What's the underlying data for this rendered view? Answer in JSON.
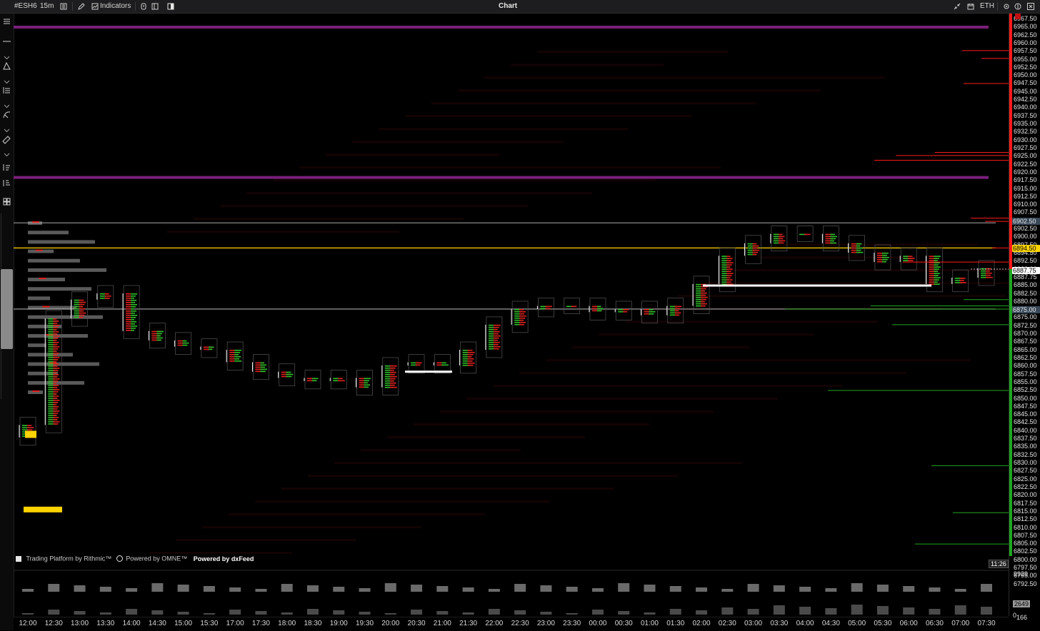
{
  "header": {
    "symbol": "#ESH6",
    "interval": "15m",
    "indicators_label": "Indicators",
    "title": "Chart",
    "session": "ETH"
  },
  "colors": {
    "background": "#000000",
    "accent_purple": "#7a1f7a",
    "accent_yellow": "#ffd400",
    "bid_red": "#e0201e",
    "ask_green": "#2ec02a",
    "axis_upper_red": "#ff1a1a",
    "axis_lower_green": "#1fa61f"
  },
  "price_axis": {
    "labels": [
      "6967.50",
      "6965.00",
      "6962.50",
      "6960.00",
      "6957.50",
      "6955.00",
      "6952.50",
      "6950.00",
      "6947.50",
      "6945.00",
      "6942.50",
      "6940.00",
      "6937.50",
      "6935.00",
      "6932.50",
      "6930.00",
      "6927.50",
      "6925.00",
      "6922.50",
      "6920.00",
      "6917.50",
      "6915.00",
      "6912.50",
      "6910.00",
      "6907.50",
      "6905.00",
      "6902.50",
      "6900.00",
      "6897.50",
      "6894.50",
      "6892.50",
      "6890.00",
      "6887.75",
      "6885.00",
      "6882.50",
      "6880.00",
      "6877.50",
      "6875.00",
      "6872.50",
      "6870.00",
      "6867.50",
      "6865.00",
      "6862.50",
      "6860.00",
      "6857.50",
      "6855.00",
      "6852.50",
      "6850.00",
      "6847.50",
      "6845.00",
      "6842.50",
      "6840.00",
      "6837.50",
      "6835.00",
      "6832.50",
      "6830.00",
      "6827.50",
      "6825.00",
      "6822.50",
      "6820.00",
      "6817.50",
      "6815.00",
      "6812.50",
      "6810.00",
      "6807.50",
      "6805.00",
      "6802.50",
      "6800.00",
      "6797.50",
      "6795.00",
      "6792.50"
    ],
    "markers": {
      "session_high": "6902.50",
      "vwap": "6894.50",
      "last": "6887.75",
      "session_low_ref": "6875.00"
    },
    "clock": "11:26"
  },
  "volume_pane": {
    "max_label": "9929",
    "current_label": "2649",
    "zero_label": "0",
    "one_label": "166"
  },
  "time_axis": [
    "12:00",
    "12:30",
    "13:00",
    "13:30",
    "14:00",
    "14:30",
    "15:00",
    "15:30",
    "17:00",
    "17:30",
    "18:00",
    "18:30",
    "19:00",
    "19:30",
    "20:00",
    "20:30",
    "21:00",
    "21:30",
    "22:00",
    "22:30",
    "23:00",
    "23:30",
    "00:00",
    "00:30",
    "01:00",
    "01:30",
    "02:00",
    "02:30",
    "03:00",
    "03:30",
    "04:00",
    "04:30",
    "05:00",
    "05:30",
    "06:00",
    "06:30",
    "07:00",
    "07:30"
  ],
  "watermark": {
    "rithmic": "Trading Platform by Rithmic™",
    "omne": "Powered by OMNE™",
    "dxfeed": "Powered by dxFeed"
  },
  "chart_data": {
    "type": "candlestick",
    "instrument": "#ESH6",
    "interval": "15m",
    "x": [
      "12:00",
      "12:30",
      "13:00",
      "13:30",
      "14:00",
      "14:30",
      "15:00",
      "15:30",
      "17:00",
      "17:30",
      "18:00",
      "18:30",
      "19:00",
      "19:30",
      "20:00",
      "20:30",
      "21:00",
      "21:30",
      "22:00",
      "22:30",
      "23:00",
      "23:30",
      "00:00",
      "00:30",
      "01:00",
      "01:30",
      "02:00",
      "02:30",
      "03:00",
      "03:30",
      "04:00",
      "04:30",
      "05:00",
      "05:30",
      "06:00",
      "06:30",
      "07:00",
      "07:30"
    ],
    "close": [
      6838,
      6872,
      6878,
      6880,
      6868,
      6865,
      6863,
      6862,
      6858,
      6855,
      6853,
      6852,
      6853,
      6850,
      6857,
      6858,
      6857,
      6862,
      6870,
      6875,
      6876,
      6876,
      6874,
      6875,
      6873,
      6876,
      6883,
      6892,
      6896,
      6899,
      6899,
      6896,
      6893,
      6890,
      6892,
      6883,
      6885,
      6888
    ],
    "ylim": [
      6792.5,
      6967.5
    ],
    "levels": [
      {
        "price": 6965.0,
        "color": "#7a1f7a"
      },
      {
        "price": 6917.0,
        "color": "#7a1f7a"
      },
      {
        "price": 6902.5,
        "color": "#8a8a8a"
      },
      {
        "price": 6894.5,
        "color": "#ffd400"
      },
      {
        "price": 6875.0,
        "color": "#8a8a8a"
      }
    ],
    "last": 6887.75
  }
}
